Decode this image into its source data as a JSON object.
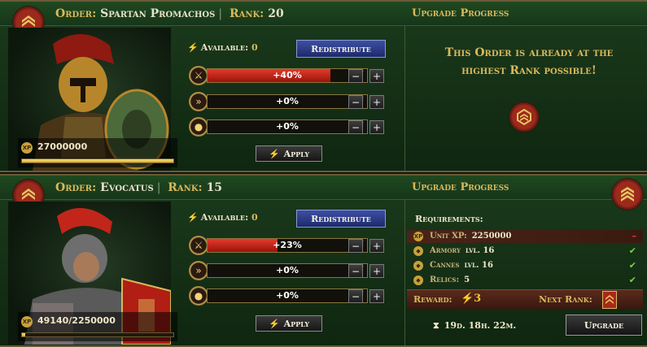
{
  "orders": [
    {
      "order_label": "Order:",
      "name": "Spartan Promachos",
      "rank_label": "Rank:",
      "rank": "20",
      "upgrade_title": "Upgrade Progress",
      "xp_icon": "XP",
      "xp": "27000000",
      "xp_progress": 1.0,
      "available_label": "Available:",
      "available": "0",
      "redistribute": "Redistribute",
      "stats": [
        {
          "icon": "crossed-swords-icon",
          "value": "+40%",
          "fill": 0.77
        },
        {
          "icon": "speed-chevrons-icon",
          "value": "+0%",
          "fill": 0
        },
        {
          "icon": "coin-bag-icon",
          "value": "+0%",
          "fill": 0
        }
      ],
      "apply": "Apply",
      "max_message": "This Order is already at the highest Rank possible!"
    },
    {
      "order_label": "Order:",
      "name": "Evocatus",
      "rank_label": "Rank:",
      "rank": "15",
      "upgrade_title": "Upgrade Progress",
      "xp_icon": "XP",
      "xp": "49140/2250000",
      "xp_progress": 0.022,
      "available_label": "Available:",
      "available": "0",
      "redistribute": "Redistribute",
      "stats": [
        {
          "icon": "crossed-swords-icon",
          "value": "+23%",
          "fill": 0.44
        },
        {
          "icon": "speed-chevrons-icon",
          "value": "+0%",
          "fill": 0
        },
        {
          "icon": "coin-bag-icon",
          "value": "+0%",
          "fill": 0
        }
      ],
      "apply": "Apply",
      "requirements_title": "Requirements:",
      "requirements": [
        {
          "icon": "XP",
          "label": "Unit XP:",
          "value": "2250000",
          "status": "–",
          "met": false
        },
        {
          "icon": "◆",
          "label": "Armory",
          "value": "lvl. 16",
          "status": "✔",
          "met": true
        },
        {
          "icon": "◆",
          "label": "Cannes",
          "value": "lvl. 16",
          "status": "✔",
          "met": true
        },
        {
          "icon": "◆",
          "label": "Relics:",
          "value": "5",
          "status": "✔",
          "met": true
        }
      ],
      "reward_label": "Reward:",
      "reward_value": "⚡3",
      "next_rank_label": "Next Rank:",
      "timer": "19d. 18h. 22m.",
      "upgrade_button": "Upgrade"
    }
  ],
  "colors": {
    "accent_gold": "#d9b85c",
    "bar_red": "#c8261a",
    "panel_green": "#1b3b1c"
  }
}
